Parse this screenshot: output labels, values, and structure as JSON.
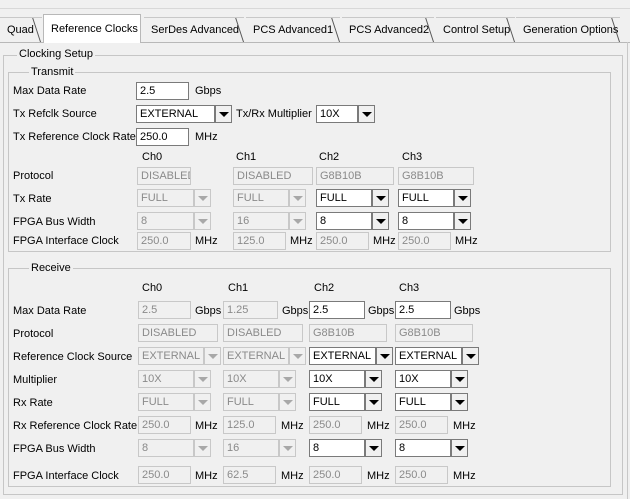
{
  "tabs": [
    "Quad",
    "Reference Clocks",
    "SerDes Advanced",
    "PCS Advanced1",
    "PCS Advanced2",
    "Control Setup",
    "Generation Options"
  ],
  "clocking_setup": {
    "title": "Clocking Setup",
    "transmit": {
      "title": "Transmit",
      "max_data_rate_label": "Max Data Rate",
      "max_data_rate_value": "2.5",
      "max_data_rate_unit": "Gbps",
      "refclk_source_label": "Tx Refclk Source",
      "refclk_source_value": "EXTERNAL",
      "multiplier_label": "Tx/Rx Multiplier",
      "multiplier_value": "10X",
      "ref_clock_rate_label": "Tx Reference Clock Rate",
      "ref_clock_rate_value": "250.0",
      "ref_clock_rate_unit": "MHz",
      "channels": [
        "Ch0",
        "Ch1",
        "Ch2",
        "Ch3"
      ],
      "protocol_label": "Protocol",
      "tx_rate_label": "Tx Rate",
      "fpga_bus_width_label": "FPGA Bus Width",
      "fpga_interface_clock_label": "FPGA Interface Clock",
      "mhz": "MHz",
      "protocol": [
        "DISABLED",
        "DISABLED",
        "G8B10B",
        "G8B10B"
      ],
      "tx_rate": [
        "FULL",
        "FULL",
        "FULL",
        "FULL"
      ],
      "fpga_bus_width": [
        "8",
        "16",
        "8",
        "8"
      ],
      "fpga_interface_clock": [
        "250.0",
        "125.0",
        "250.0",
        "250.0"
      ]
    },
    "receive": {
      "title": "Receive",
      "channels": [
        "Ch0",
        "Ch1",
        "Ch2",
        "Ch3"
      ],
      "max_data_rate_label": "Max Data Rate",
      "protocol_label": "Protocol",
      "ref_clock_source_label": "Reference Clock Source",
      "multiplier_label": "Multiplier",
      "rx_rate_label": "Rx Rate",
      "rx_ref_clock_rate_label": "Rx Reference Clock Rate",
      "fpga_bus_width_label": "FPGA Bus Width",
      "fpga_interface_clock_label": "FPGA Interface Clock",
      "gbps": "Gbps",
      "mhz": "MHz",
      "max_data_rate": [
        "2.5",
        "1.25",
        "2.5",
        "2.5"
      ],
      "protocol": [
        "DISABLED",
        "DISABLED",
        "G8B10B",
        "G8B10B"
      ],
      "ref_clock_source": [
        "EXTERNAL",
        "EXTERNAL",
        "EXTERNAL",
        "EXTERNAL"
      ],
      "multiplier": [
        "10X",
        "10X",
        "10X",
        "10X"
      ],
      "rx_rate": [
        "FULL",
        "FULL",
        "FULL",
        "FULL"
      ],
      "rx_ref_clock_rate": [
        "250.0",
        "125.0",
        "250.0",
        "250.0"
      ],
      "fpga_bus_width": [
        "8",
        "16",
        "8",
        "8"
      ],
      "fpga_interface_clock": [
        "250.0",
        "62.5",
        "250.0",
        "250.0"
      ]
    }
  }
}
